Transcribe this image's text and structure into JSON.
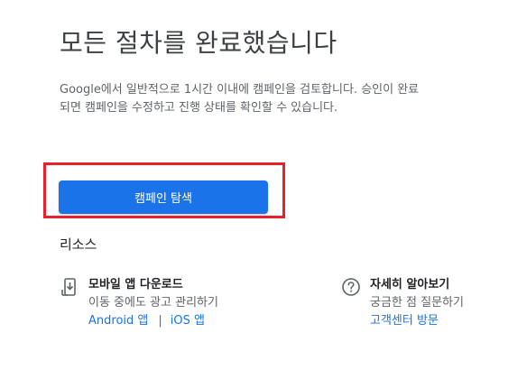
{
  "header": {
    "title": "모든 절차를 완료했습니다"
  },
  "description": "Google에서 일반적으로 1시간 이내에 캠페인을 검토합니다. 승인이 완료되면 캠페인을 수정하고 진행 상태를 확인할 수 있습니다.",
  "primary_button": {
    "label": "캠페인 탐색",
    "color": "#1a73e8"
  },
  "highlight_color": "#e8202a",
  "resources": {
    "heading": "리소스",
    "mobile": {
      "icon": "mobile-download-icon",
      "title": "모바일 앱 다운로드",
      "subtitle": "이동 중에도 광고 관리하기",
      "links": {
        "android": "Android 앱",
        "separator": "|",
        "ios": "iOS 앱"
      }
    },
    "help": {
      "icon": "help-icon",
      "title": "자세히 알아보기",
      "subtitle": "궁금한 점 질문하기",
      "link": "고객센터 방문"
    }
  }
}
